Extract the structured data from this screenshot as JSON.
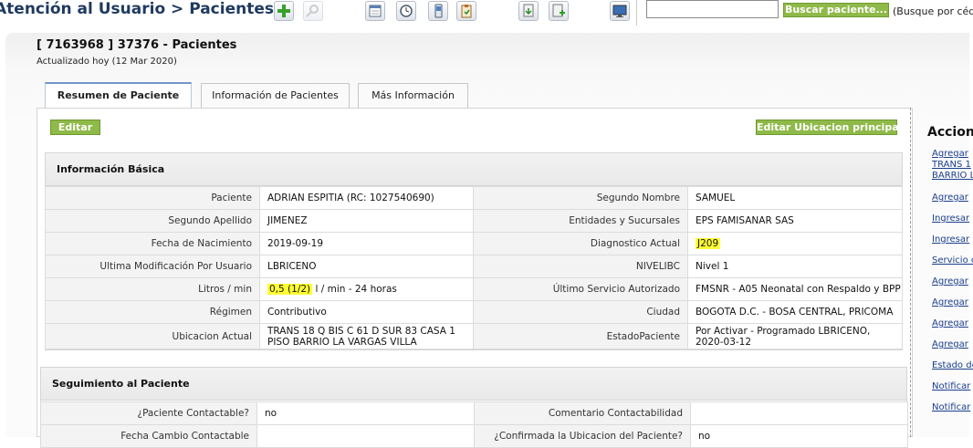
{
  "header": {
    "title": "Atención al Usuario > Pacientes",
    "toolbar_icons": [
      "add-icon",
      "search-disabled-icon",
      "calendar-icon",
      "clock-icon",
      "phone-icon",
      "clipboard-icon",
      "document-download-icon",
      "document-add-icon",
      "monitor-icon"
    ]
  },
  "search": {
    "value": "",
    "button_label": "Buscar paciente...",
    "hint": "(Busque por cédu"
  },
  "patient": {
    "header": "[ 7163968 ] 37376 - Pacientes",
    "updated": "Actualizado hoy (12 Mar 2020)"
  },
  "tabs": [
    {
      "label": "Resumen de Paciente",
      "active": true
    },
    {
      "label": "Información de Pacientes",
      "active": false
    },
    {
      "label": "Más Información",
      "active": false
    }
  ],
  "buttons": {
    "edit": "Editar",
    "edit_location": "Editar Ubicacion principal"
  },
  "basic_info": {
    "title": "Información Básica",
    "rows": [
      {
        "label1": "Paciente",
        "value1": "ADRIAN ESPITIA (RC: 1027540690)",
        "label2": "Segundo Nombre",
        "value2": "SAMUEL"
      },
      {
        "label1": "Segundo Apellido",
        "value1": "JIMENEZ",
        "label2": "Entidades y Sucursales",
        "value2": "EPS FAMISANAR SAS"
      },
      {
        "label1": "Fecha de Nacimiento",
        "value1": "2019-09-19",
        "label2": "Diagnostico Actual",
        "value2": "J209"
      },
      {
        "label1": "Ultima Modificación Por Usuario",
        "value1": "LBRICENO",
        "label2": "NIVELIBC",
        "value2": "Nivel 1"
      },
      {
        "label1": "Litros / min",
        "value1_highlight": "0,5 (1/2)",
        "value1_rest": "l / min - 24 horas",
        "label2": "Último Servicio Autorizado",
        "value2": "FMSNR - A05 Neonatal con Respaldo y BPP"
      },
      {
        "label1": "Régimen",
        "value1": "Contributivo",
        "label2": "Ciudad",
        "value2": "BOGOTA D.C. - BOSA CENTRAL, PRICOMA"
      },
      {
        "label1": "Ubicacion Actual",
        "value1": "TRANS 18 Q BIS C 61 D SUR 83 CASA 1 PISO BARRIO LA VARGAS VILLA",
        "label2": "EstadoPaciente",
        "value2": "Por Activar - Programado LBRICENO, 2020-03-12"
      }
    ]
  },
  "followup": {
    "title": "Seguimiento al Paciente",
    "rows": [
      {
        "label1": "¿Paciente Contactable?",
        "value1": "no",
        "label2": "Comentario Contactabilidad",
        "value2": ""
      },
      {
        "label1": "Fecha Cambio Contactable",
        "value1": "",
        "label2": "¿Confirmada la Ubicacion del Paciente?",
        "value2": "no"
      }
    ]
  },
  "actions": {
    "title": "Acciones",
    "links": [
      "Agregar",
      "TRANS 1",
      "BARRIO L",
      "Agregar",
      "Ingresar",
      "Ingresar",
      "Servicio c",
      "Agregar",
      "Agregar",
      "Agregar",
      "Agregar",
      "Estado de",
      "Notificar",
      "Notificar"
    ]
  },
  "colors": {
    "button_green": "#8fb949",
    "highlight_yellow": "#ffff33",
    "title_blue": "#1f3a5f",
    "link_blue": "#1a3e8c"
  }
}
